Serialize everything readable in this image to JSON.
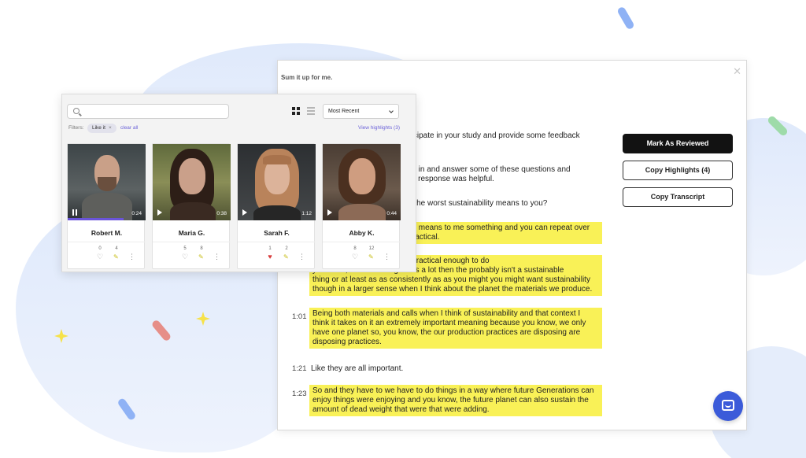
{
  "transcript_panel": {
    "prompt": "Sum it up for me.",
    "close_icon": "close-icon",
    "actions": {
      "mark_reviewed": "Mark As Reviewed",
      "copy_highlights": "Copy Highlights (4)",
      "copy_transcript": "Copy Transcript"
    },
    "lines": [
      {
        "text": "articipate in your study and provide some feedback"
      },
      {
        "text": "ght in and answer some of these questions and"
      },
      {
        "text": "my response was helpful."
      },
      {
        "text": "es the worst sustainability means to you?"
      }
    ],
    "highlights": [
      {
        "text": "y means to me something and you can repeat over\nractical."
      },
      {
        "text": "t over and over again and is practical enough to do\nyou know, if it something takes a lot then the probably isn't a sustainable\nthing or at least as as consistently as as you might you might want sustainability\nthough in a larger sense when I think about the planet the materials we produce."
      },
      {
        "time": "1:01",
        "text": "Being both materials and calls when I think of sustainability and that context I\nthink it takes on it an extremely important meaning because you know, we only\nhave one planet so, you know, the our production practices are disposing are\ndisposing practices."
      },
      {
        "time": "1:23",
        "text": "So and they have to we have to do things in a way where future Generations can\nenjoy things were enjoying and you know, the future planet can also sustain the\namount of dead weight that were that were adding."
      }
    ],
    "plain_line": {
      "time": "1:21",
      "text": "Like they are all important."
    },
    "chat_icon": "chat-icon"
  },
  "video_grid": {
    "search": {
      "placeholder": ""
    },
    "sort": {
      "selected": "Most Recent"
    },
    "filters": {
      "label": "Filters:",
      "chip": "Like it",
      "chip_remove": "×",
      "clear": "clear all"
    },
    "view_highlights": "View highlights (3)",
    "cards": [
      {
        "name": "Robert M.",
        "duration": "0:24",
        "likes": "0",
        "highlights": "4",
        "liked": false,
        "playing": true,
        "progress": 0.72
      },
      {
        "name": "Maria G.",
        "duration": "0:38",
        "likes": "5",
        "highlights": "8",
        "liked": false,
        "playing": false,
        "progress": 0
      },
      {
        "name": "Sarah F.",
        "duration": "1:12",
        "likes": "1",
        "highlights": "2",
        "liked": true,
        "playing": false,
        "progress": 0
      },
      {
        "name": "Abby K.",
        "duration": "0:44",
        "likes": "8",
        "highlights": "12",
        "liked": false,
        "playing": false,
        "progress": 0
      }
    ],
    "icons": {
      "heart": "♥",
      "heart_outline": "♡",
      "pencil": "✎",
      "more": "⋮"
    }
  },
  "colors": {
    "highlight": "#f9f157",
    "accent": "#6a54d9",
    "primary_button": "#121212",
    "chat_button": "#3b5bd9",
    "liked": "#d83b3b"
  }
}
